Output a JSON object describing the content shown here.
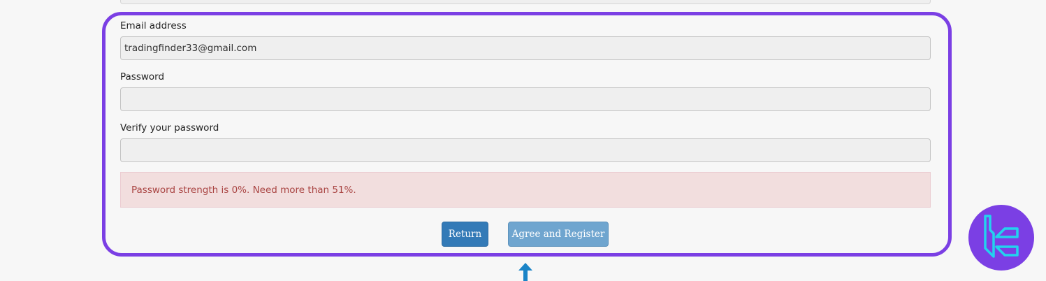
{
  "form": {
    "email": {
      "label": "Email address",
      "value": "tradingfinder33@gmail.com"
    },
    "password": {
      "label": "Password",
      "value": ""
    },
    "verify_password": {
      "label": "Verify your password",
      "value": ""
    },
    "alert_message": "Password strength is 0%. Need more than 51%.",
    "buttons": {
      "return_label": "Return",
      "register_label": "Agree and Register"
    }
  },
  "colors": {
    "highlight_frame": "#7b3fe4",
    "alert_background": "#f2dede",
    "alert_text": "#a94442",
    "primary_button": "#337ab7",
    "disabled_button": "#6fa5cf",
    "arrow": "#1a84c7",
    "logo_circle": "#7b3fe4",
    "logo_mark": "#22d3ee"
  },
  "icons": {
    "arrow": "arrow-up-icon",
    "logo": "tradingfinder-logo"
  }
}
